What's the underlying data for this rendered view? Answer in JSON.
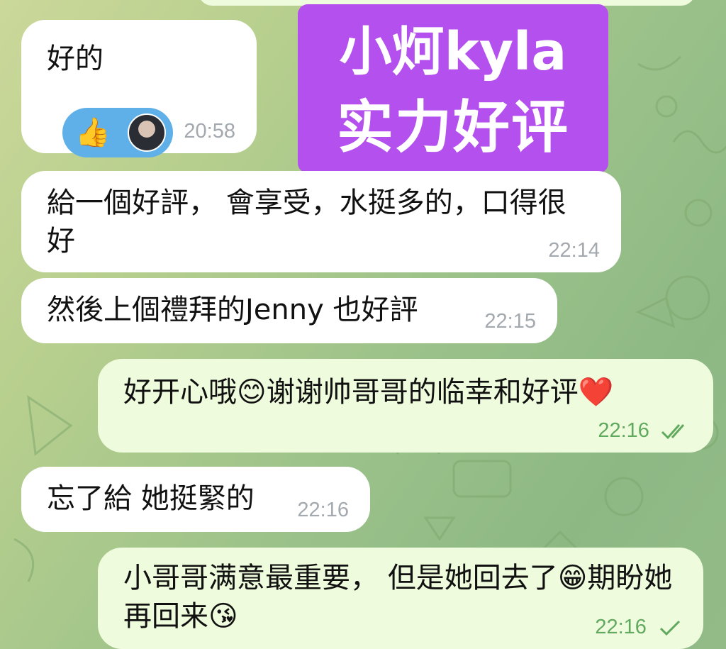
{
  "overlay": {
    "line1": "小炣kyla",
    "line2": "实力好评"
  },
  "messages": [
    {
      "id": "m1",
      "dir": "in",
      "text": "好的",
      "time": "20:58"
    },
    {
      "id": "m2",
      "dir": "in",
      "text": "給一個好評， 會享受，水挺多的，口得很好",
      "time": "22:14"
    },
    {
      "id": "m3",
      "dir": "in",
      "text": "然後上個禮拜的Jenny 也好評",
      "time": "22:15"
    },
    {
      "id": "m4",
      "dir": "out",
      "text": "好开心哦😊谢谢帅哥哥的临幸和好评❤️",
      "time": "22:16",
      "status": "read"
    },
    {
      "id": "m5",
      "dir": "in",
      "text": "忘了給 她挺緊的",
      "time": "22:16"
    },
    {
      "id": "m6",
      "dir": "out",
      "text": "小哥哥满意最重要， 但是她回去了😁期盼她再回来😘",
      "time": "22:16",
      "status": "sent"
    }
  ],
  "reaction": {
    "emoji": "👍",
    "icon": "avatar"
  },
  "colors": {
    "incoming_bubble": "#ffffff",
    "outgoing_bubble": "#eefbdc",
    "outgoing_meta": "#62a960",
    "incoming_meta": "#a3a9ae",
    "overlay": "#b451ee",
    "reaction_pill": "#5fb0e8"
  }
}
